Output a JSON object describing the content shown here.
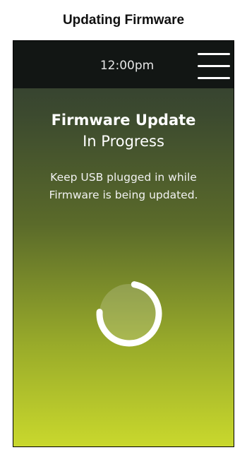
{
  "page": {
    "caption": "Updating Firmware"
  },
  "status_bar": {
    "time": "12:00pm",
    "menu_icon": "hamburger-menu-icon"
  },
  "main": {
    "title": "Firmware Update",
    "subtitle": "In Progress",
    "message_line1": "Keep USB plugged in while",
    "message_line2": "Firmware is being updated."
  },
  "spinner": {
    "icon": "loading-spinner-icon",
    "arc_fraction": 0.73
  },
  "colors": {
    "top_bar": "#121614",
    "gradient_top": "#2f3a31",
    "gradient_bottom": "#c9d82d",
    "text": "#ffffff"
  }
}
